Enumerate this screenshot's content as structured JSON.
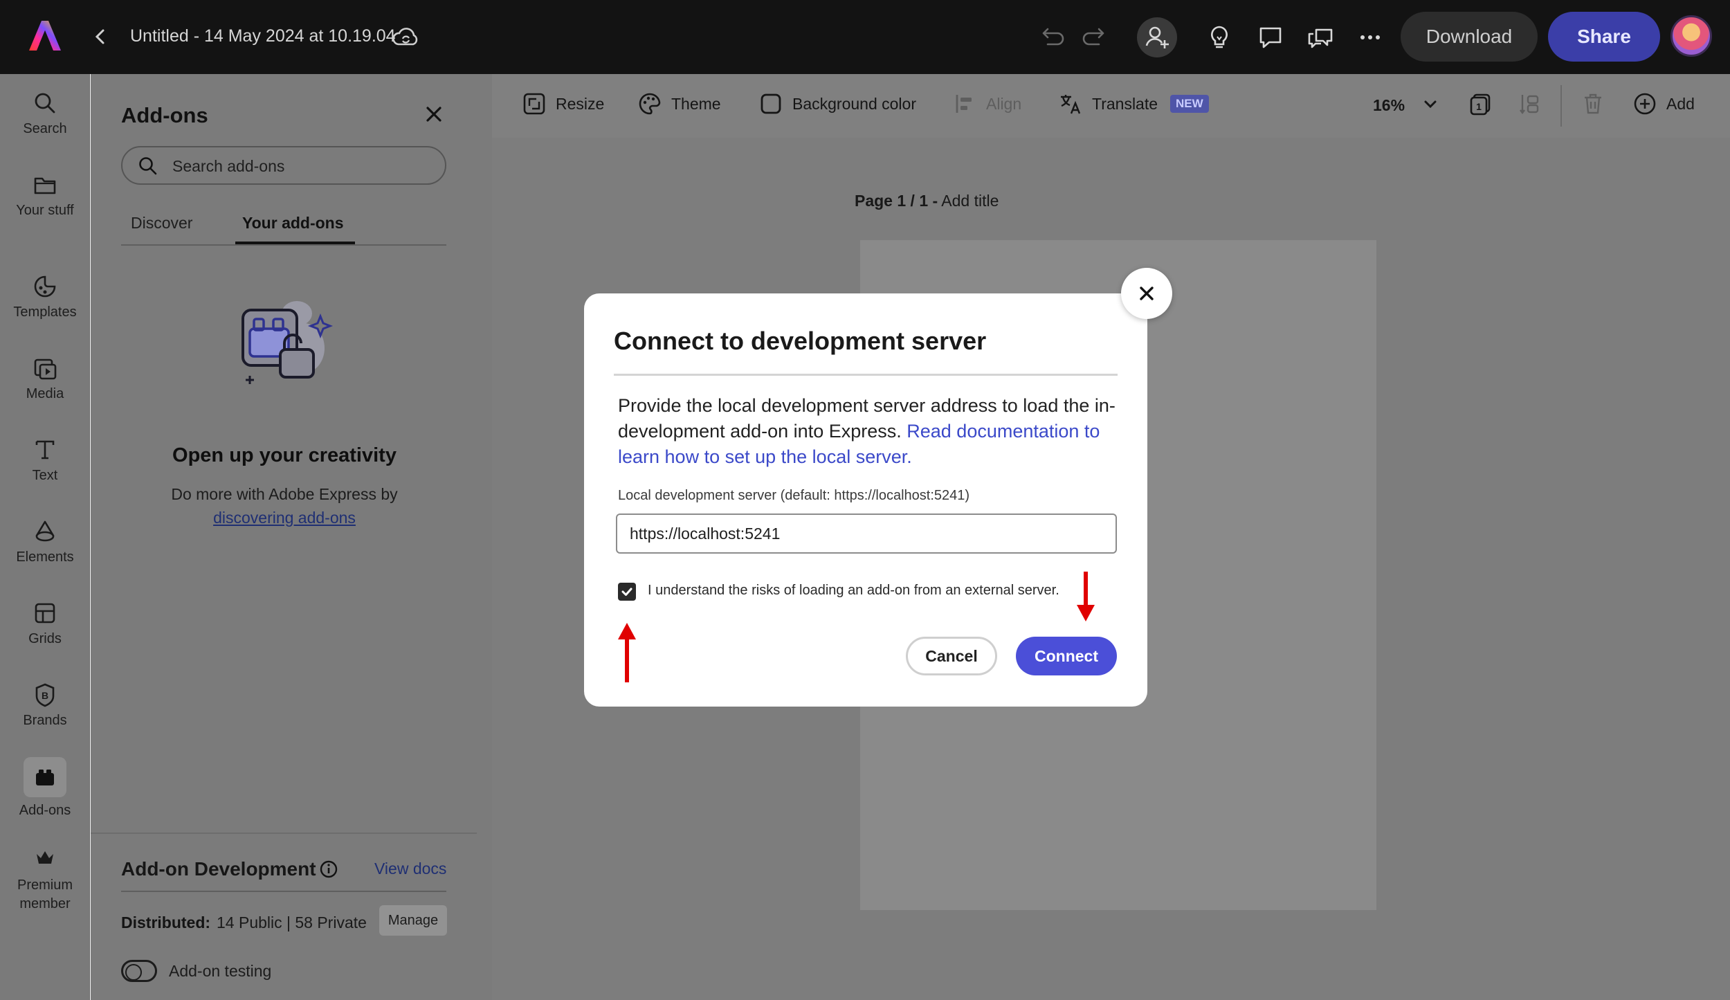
{
  "header": {
    "document_title": "Untitled - 14 May 2024 at 10.19.04",
    "download_label": "Download",
    "share_label": "Share"
  },
  "rail": {
    "items": [
      {
        "label": "Search",
        "icon": "search-icon"
      },
      {
        "label": "Your stuff",
        "icon": "folder-icon"
      },
      {
        "label": "Templates",
        "icon": "templates-icon"
      },
      {
        "label": "Media",
        "icon": "media-icon"
      },
      {
        "label": "Text",
        "icon": "text-icon"
      },
      {
        "label": "Elements",
        "icon": "elements-icon"
      },
      {
        "label": "Grids",
        "icon": "grids-icon"
      },
      {
        "label": "Brands",
        "icon": "brands-icon"
      },
      {
        "label": "Add-ons",
        "icon": "add-ons-icon",
        "active": true
      },
      {
        "label": "Premium member",
        "icon": "crown-icon"
      }
    ]
  },
  "addons_panel": {
    "title": "Add-ons",
    "search_placeholder": "Search add-ons",
    "tabs": [
      "Discover",
      "Your add-ons"
    ],
    "active_tab": "Your add-ons",
    "empty_title": "Open up your creativity",
    "empty_text": "Do more with Adobe Express by",
    "empty_link": "discovering add-ons",
    "dev": {
      "title": "Add-on Development",
      "view_docs": "View docs",
      "distributed_label": "Distributed:",
      "distributed_value": "14 Public | 58 Private",
      "manage_label": "Manage",
      "testing_label": "Add-on testing",
      "testing_enabled": false
    }
  },
  "toolbar": {
    "resize": "Resize",
    "theme": "Theme",
    "background_color": "Background color",
    "align": "Align",
    "translate": "Translate",
    "new_badge": "NEW",
    "zoom": "16%",
    "add": "Add"
  },
  "canvas": {
    "page_label_bold": "Page 1 / 1 -",
    "page_label_title": "Add title"
  },
  "modal": {
    "title": "Connect to development server",
    "desc_text": "Provide the local development server address to load the in-development add-on into Express. ",
    "desc_link": "Read documentation to learn how to set up the local server.",
    "field_label": "Local development server (default: https://localhost:5241)",
    "field_value": "https://localhost:5241",
    "checkbox_label": "I understand the risks of loading an add-on from an external server.",
    "checkbox_checked": true,
    "cancel_label": "Cancel",
    "connect_label": "Connect"
  },
  "colors": {
    "accent": "#4b4fd8",
    "share": "#3b3ea8",
    "annotation_arrow": "#e00000"
  }
}
